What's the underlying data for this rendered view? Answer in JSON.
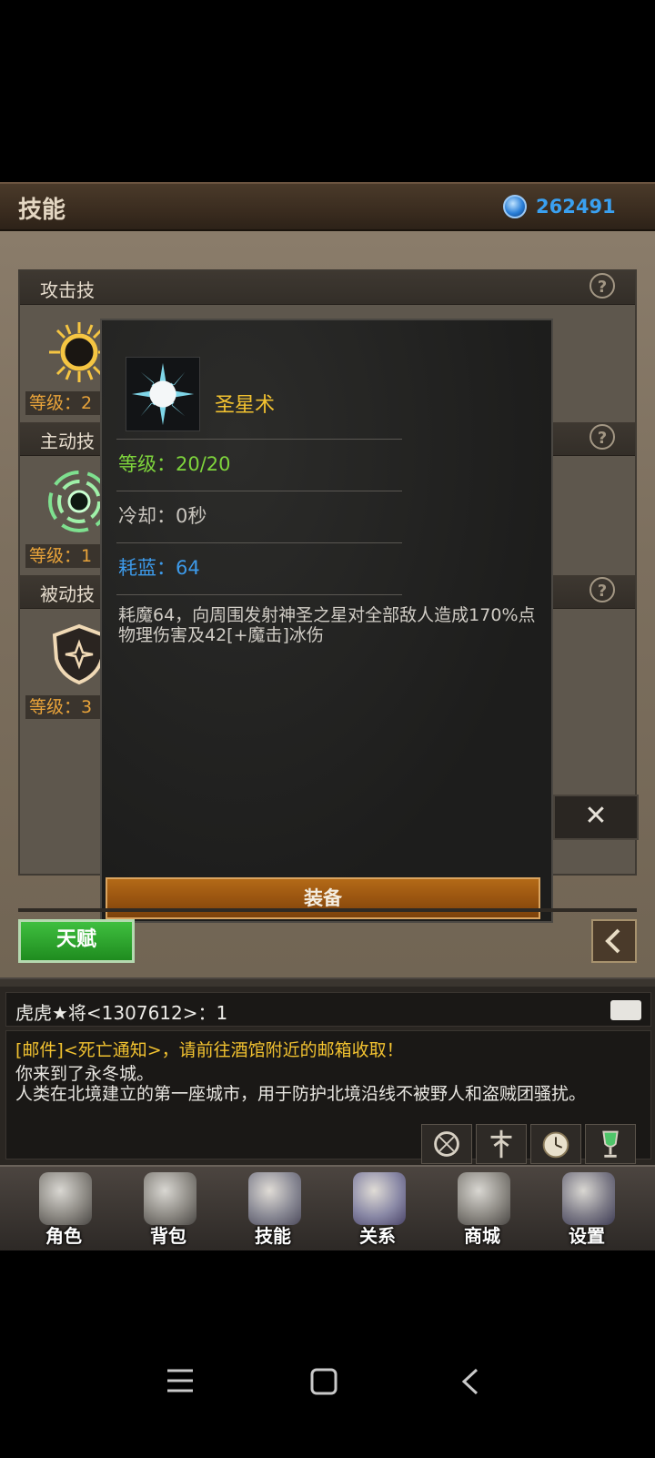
{
  "header": {
    "title": "技能",
    "gems": "262491"
  },
  "sections": [
    {
      "title": "攻击技",
      "level": "等级：2"
    },
    {
      "title": "主动技",
      "level": "等级：1"
    },
    {
      "title": "被动技",
      "level": "等级：3"
    }
  ],
  "popup": {
    "skill_name": "圣星术",
    "level": "等级：20/20",
    "cooldown": "冷却：0秒",
    "mana": "耗蓝：64",
    "description": "耗魔64，向周围发射神圣之星对全部敌人造成170%点物理伤害及42[+魔击]冰伤",
    "equip_label": "装备"
  },
  "help_glyph": "?",
  "close_glyph": "✕",
  "talent_label": "天赋",
  "chat": {
    "user_line": "虎虎★将<1307612>：1",
    "mail_line": "[邮件]<死亡通知>，请前往酒馆附近的邮箱收取！",
    "message": "你来到了永冬城。\n人类在北境建立的第一座城市，用于防护北境沿线不被野人和盗贼团骚扰。",
    "buttons": [
      "compass-icon",
      "totem-icon",
      "clock-icon",
      "trophy-icon"
    ]
  },
  "nav": [
    {
      "label": "角色",
      "icon": "helmet-icon"
    },
    {
      "label": "背包",
      "icon": "bag-icon"
    },
    {
      "label": "技能",
      "icon": "book-icon"
    },
    {
      "label": "关系",
      "icon": "gauntlets-icon"
    },
    {
      "label": "商城",
      "icon": "chest-icon"
    },
    {
      "label": "设置",
      "icon": "gear-icon"
    }
  ],
  "colors": {
    "level_gold": "#e8a33a",
    "level_green": "#7ed43c",
    "mana_blue": "#3d9ae9",
    "name_gold": "#f2c230",
    "gem_blue": "#3aa0f0",
    "talent_green": "#2aa62a"
  }
}
